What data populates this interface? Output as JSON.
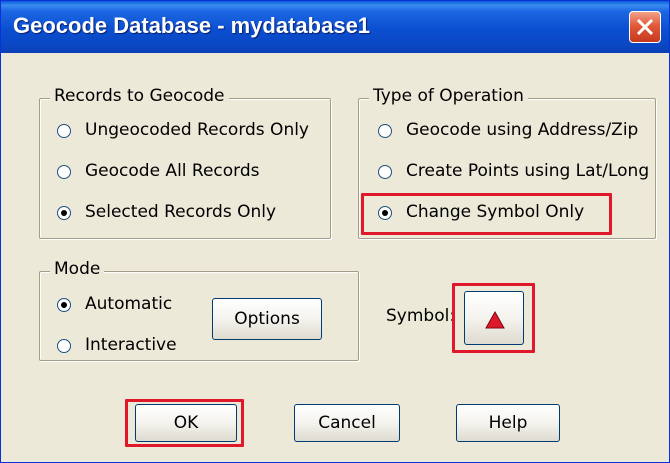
{
  "window": {
    "title": "Geocode Database - mydatabase1",
    "close_label": "Close"
  },
  "records_group": {
    "legend": "Records to Geocode",
    "options": [
      {
        "label": "Ungeocoded Records Only",
        "checked": false
      },
      {
        "label": "Geocode All Records",
        "checked": false
      },
      {
        "label": "Selected Records Only",
        "checked": true
      }
    ]
  },
  "operation_group": {
    "legend": "Type of Operation",
    "options": [
      {
        "label": "Geocode using Address/Zip",
        "checked": false
      },
      {
        "label": "Create Points using Lat/Long",
        "checked": false
      },
      {
        "label": "Change Symbol Only",
        "checked": true
      }
    ]
  },
  "mode_group": {
    "legend": "Mode",
    "options": [
      {
        "label": "Automatic",
        "checked": true
      },
      {
        "label": "Interactive",
        "checked": false
      }
    ],
    "options_button": "Options"
  },
  "symbol": {
    "label": "Symbol:",
    "icon": "red-triangle-icon",
    "color": "#e0182b"
  },
  "buttons": {
    "ok": "OK",
    "cancel": "Cancel",
    "help": "Help"
  },
  "annotation_color": "#e0182b"
}
